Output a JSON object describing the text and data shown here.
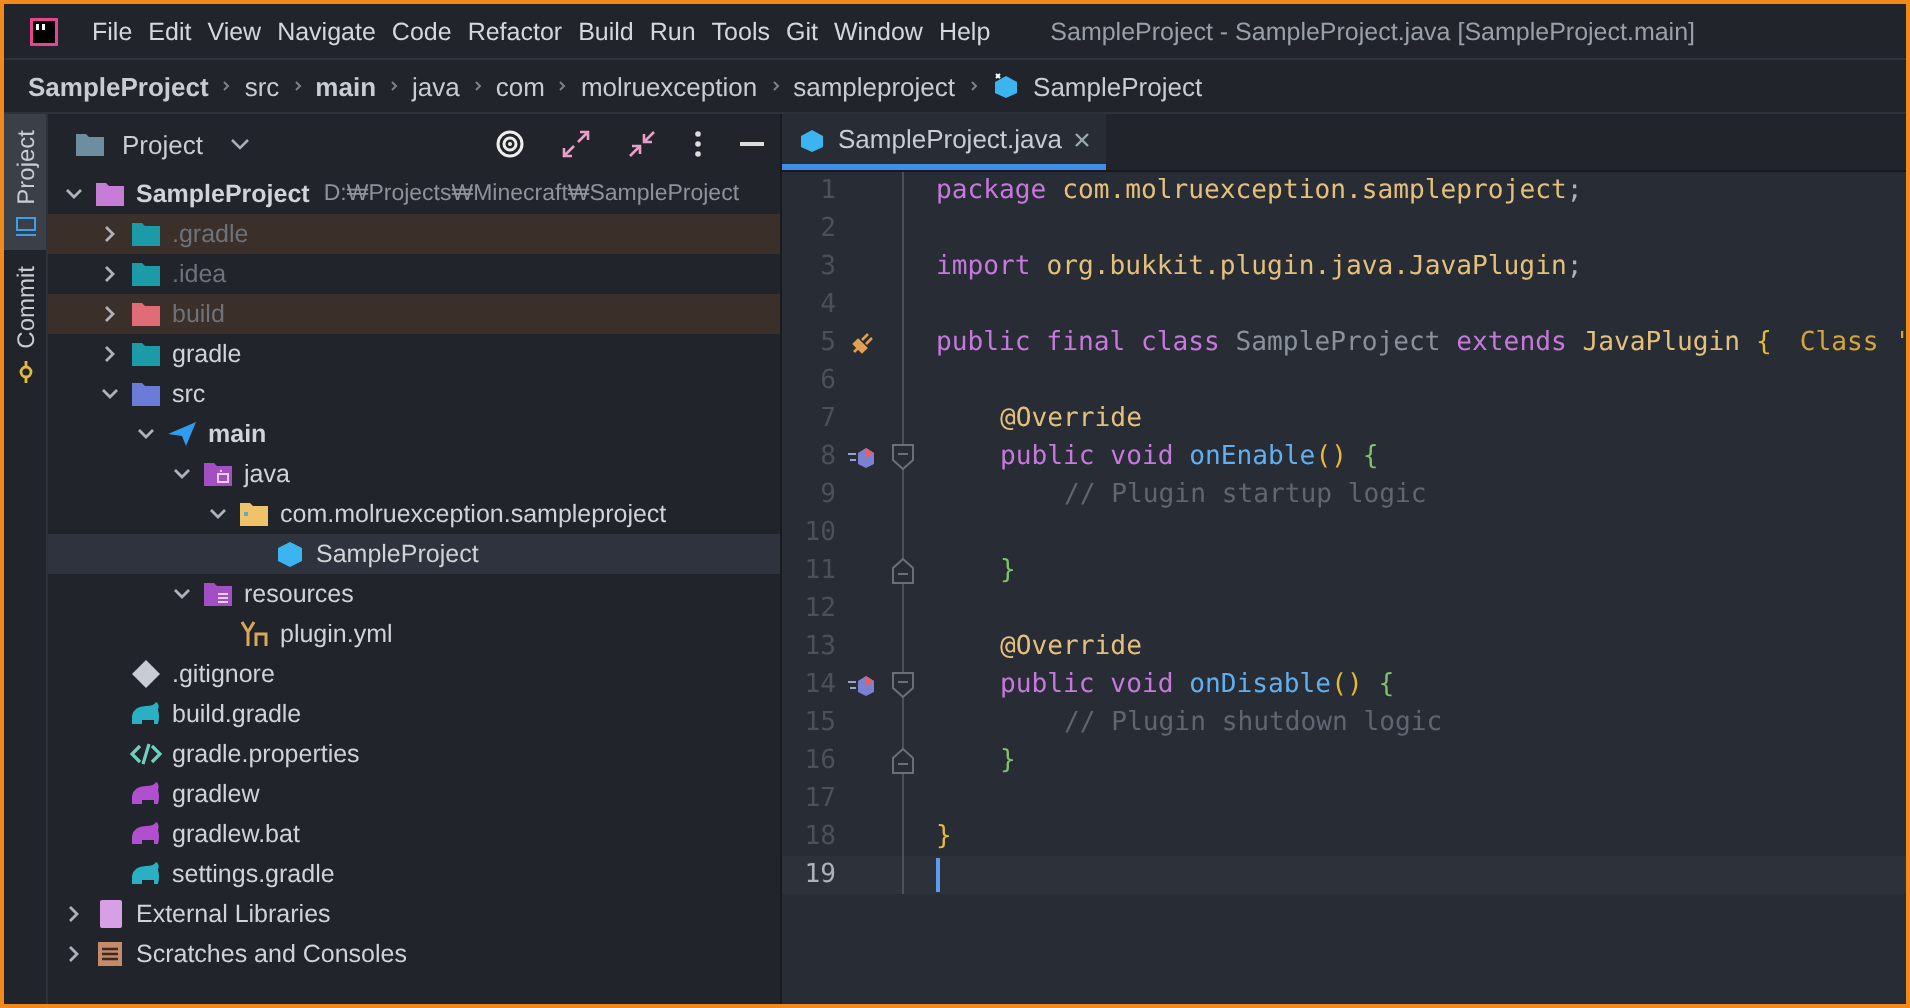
{
  "window": {
    "title": "SampleProject - SampleProject.java [SampleProject.main]"
  },
  "menu": [
    "File",
    "Edit",
    "View",
    "Navigate",
    "Code",
    "Refactor",
    "Build",
    "Run",
    "Tools",
    "Git",
    "Window",
    "Help"
  ],
  "breadcrumb": [
    {
      "label": "SampleProject",
      "bold": true
    },
    {
      "label": "src",
      "bold": false
    },
    {
      "label": "main",
      "bold": true
    },
    {
      "label": "java",
      "bold": false
    },
    {
      "label": "com",
      "bold": false
    },
    {
      "label": "molruexception",
      "bold": false
    },
    {
      "label": "sampleproject",
      "bold": false
    },
    {
      "label": "SampleProject",
      "bold": false
    }
  ],
  "side_tabs": [
    {
      "label": "Project",
      "selected": true
    },
    {
      "label": "Commit",
      "selected": false
    }
  ],
  "project_panel": {
    "title": "Project",
    "tree": [
      {
        "name": "SampleProject",
        "path": "D:₩Projects₩Minecraft₩SampleProject",
        "kind": "module",
        "bold": true,
        "excluded": false,
        "ignored": false,
        "selected": false,
        "expanded": true,
        "children": [
          {
            "name": ".gradle",
            "kind": "gradle-folder",
            "bold": false,
            "excluded": true,
            "ignored": true,
            "selected": false,
            "expanded": false
          },
          {
            "name": ".idea",
            "kind": "idea-folder",
            "bold": false,
            "excluded": false,
            "ignored": true,
            "selected": false,
            "expanded": false
          },
          {
            "name": "build",
            "kind": "build-folder",
            "bold": false,
            "excluded": true,
            "ignored": true,
            "selected": false,
            "expanded": false
          },
          {
            "name": "gradle",
            "kind": "gradle-folder",
            "bold": false,
            "excluded": false,
            "ignored": false,
            "selected": false,
            "expanded": false
          },
          {
            "name": "src",
            "kind": "source-folder",
            "bold": false,
            "excluded": false,
            "ignored": false,
            "selected": false,
            "expanded": true,
            "children": [
              {
                "name": "main",
                "kind": "plane",
                "bold": true,
                "excluded": false,
                "ignored": false,
                "selected": false,
                "expanded": true,
                "children": [
                  {
                    "name": "java",
                    "kind": "java-folder",
                    "bold": false,
                    "excluded": false,
                    "ignored": false,
                    "selected": false,
                    "expanded": true,
                    "children": [
                      {
                        "name": "com.molruexception.sampleproject",
                        "kind": "package",
                        "bold": false,
                        "excluded": false,
                        "ignored": false,
                        "selected": false,
                        "expanded": true,
                        "children": [
                          {
                            "name": "SampleProject",
                            "kind": "class",
                            "bold": false,
                            "excluded": false,
                            "ignored": false,
                            "selected": true
                          }
                        ]
                      }
                    ]
                  },
                  {
                    "name": "resources",
                    "kind": "resources-folder",
                    "bold": false,
                    "excluded": false,
                    "ignored": false,
                    "selected": false,
                    "expanded": true,
                    "children": [
                      {
                        "name": "plugin.yml",
                        "kind": "yaml",
                        "bold": false,
                        "excluded": false,
                        "ignored": false,
                        "selected": false
                      }
                    ]
                  }
                ]
              }
            ]
          },
          {
            "name": ".gitignore",
            "kind": "git",
            "bold": false,
            "excluded": false,
            "ignored": false,
            "selected": false
          },
          {
            "name": "build.gradle",
            "kind": "gradle-file",
            "bold": false,
            "excluded": false,
            "ignored": false,
            "selected": false
          },
          {
            "name": "gradle.properties",
            "kind": "properties",
            "bold": false,
            "excluded": false,
            "ignored": false,
            "selected": false
          },
          {
            "name": "gradlew",
            "kind": "gradlew",
            "bold": false,
            "excluded": false,
            "ignored": false,
            "selected": false
          },
          {
            "name": "gradlew.bat",
            "kind": "gradlew",
            "bold": false,
            "excluded": false,
            "ignored": false,
            "selected": false
          },
          {
            "name": "settings.gradle",
            "kind": "gradle-file",
            "bold": false,
            "excluded": false,
            "ignored": false,
            "selected": false
          }
        ]
      },
      {
        "name": "External Libraries",
        "kind": "library",
        "bold": false,
        "excluded": false,
        "ignored": false,
        "selected": false,
        "expanded": false
      },
      {
        "name": "Scratches and Consoles",
        "kind": "scratches",
        "bold": false,
        "excluded": false,
        "ignored": false,
        "selected": false,
        "expanded": false
      }
    ]
  },
  "editor": {
    "tabs": [
      {
        "label": "SampleProject.java",
        "selected": true
      }
    ],
    "lines": [
      {
        "number": "1",
        "selected": false,
        "kind": "plain",
        "tokens": [
          {
            "kind": "keyword",
            "text": "package "
          },
          {
            "kind": "name",
            "text": "com.molruexception.sampleproject"
          },
          {
            "kind": "plain",
            "text": ";"
          }
        ]
      },
      {
        "number": "2",
        "selected": false,
        "kind": "plain"
      },
      {
        "number": "3",
        "selected": false,
        "kind": "plain",
        "tokens": [
          {
            "kind": "keyword",
            "text": "import "
          },
          {
            "kind": "name",
            "text": "org.bukkit.plugin.java.JavaPlugin"
          },
          {
            "kind": "plain",
            "text": ";"
          }
        ]
      },
      {
        "number": "4",
        "selected": false,
        "kind": "plain"
      },
      {
        "number": "5",
        "selected": false,
        "kind": "class-declaration",
        "tokens": [
          {
            "kind": "keyword",
            "text": "public final class "
          },
          {
            "kind": "unused",
            "text": "SampleProject "
          },
          {
            "kind": "keyword",
            "text": "extends "
          },
          {
            "kind": "name",
            "text": "JavaPlugin "
          },
          {
            "kind": "open-brace",
            "text": "{"
          },
          {
            "kind": "hint",
            "text": "Class '"
          }
        ]
      },
      {
        "number": "6",
        "selected": false,
        "kind": "plain"
      },
      {
        "number": "7",
        "selected": false,
        "kind": "plain",
        "tokens": [
          {
            "kind": "annotation",
            "text": "@Override"
          }
        ]
      },
      {
        "number": "8",
        "selected": false,
        "kind": "method-declaration",
        "tokens": [
          {
            "kind": "keyword",
            "text": "public void "
          },
          {
            "kind": "method",
            "text": "onEnable"
          },
          {
            "kind": "paren",
            "text": "() "
          },
          {
            "kind": "open-brace",
            "text": "{"
          }
        ]
      },
      {
        "number": "9",
        "selected": false,
        "kind": "plain",
        "tokens": [
          {
            "kind": "comment",
            "text": "// Plugin startup logic"
          }
        ]
      },
      {
        "number": "10",
        "selected": false,
        "kind": "plain"
      },
      {
        "number": "11",
        "selected": false,
        "kind": "block-end",
        "tokens": [
          {
            "kind": "close-brace",
            "text": "}"
          }
        ]
      },
      {
        "number": "12",
        "selected": false,
        "kind": "plain"
      },
      {
        "number": "13",
        "selected": false,
        "kind": "plain",
        "tokens": [
          {
            "kind": "annotation",
            "text": "@Override"
          }
        ]
      },
      {
        "number": "14",
        "selected": false,
        "kind": "method-declaration",
        "tokens": [
          {
            "kind": "keyword",
            "text": "public void "
          },
          {
            "kind": "method",
            "text": "onDisable"
          },
          {
            "kind": "paren",
            "text": "() "
          },
          {
            "kind": "open-brace",
            "text": "{"
          }
        ]
      },
      {
        "number": "15",
        "selected": false,
        "kind": "plain",
        "tokens": [
          {
            "kind": "comment",
            "text": "// Plugin shutdown logic"
          }
        ]
      },
      {
        "number": "16",
        "selected": false,
        "kind": "block-end",
        "tokens": [
          {
            "kind": "close-brace",
            "text": "}"
          }
        ]
      },
      {
        "number": "17",
        "selected": false,
        "kind": "plain"
      },
      {
        "number": "18",
        "selected": false,
        "kind": "plain",
        "tokens": [
          {
            "kind": "close-brace",
            "text": "}"
          }
        ]
      },
      {
        "number": "19",
        "selected": true,
        "kind": "plain"
      }
    ]
  }
}
